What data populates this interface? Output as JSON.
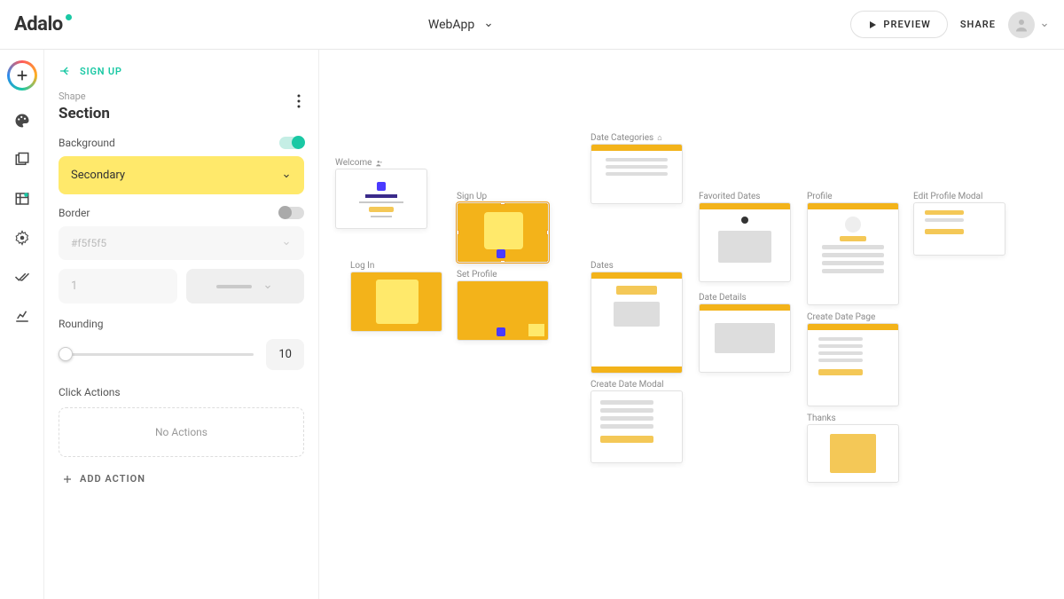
{
  "header": {
    "logo": "Adalo",
    "app_name": "WebApp",
    "preview": "PREVIEW",
    "share": "SHARE"
  },
  "breadcrumb": {
    "back_label": "SIGN UP"
  },
  "panel": {
    "subtitle": "Shape",
    "title": "Section",
    "background_label": "Background",
    "background_on": true,
    "bg_color_name": "Secondary",
    "border_label": "Border",
    "border_on": false,
    "border_color": "#f5f5f5",
    "border_width": "1",
    "rounding_label": "Rounding",
    "rounding_value": "10",
    "click_actions_label": "Click Actions",
    "no_actions": "No Actions",
    "add_action": "ADD ACTION"
  },
  "screens": {
    "welcome": "Welcome",
    "login": "Log In",
    "signup": "Sign Up",
    "set_profile": "Set Profile",
    "date_categories": "Date Categories",
    "dates": "Dates",
    "create_date_modal": "Create Date Modal",
    "favorited_dates": "Favorited Dates",
    "date_details": "Date Details",
    "profile": "Profile",
    "create_date_page": "Create Date Page",
    "thanks": "Thanks",
    "edit_profile_modal": "Edit Profile Modal"
  }
}
